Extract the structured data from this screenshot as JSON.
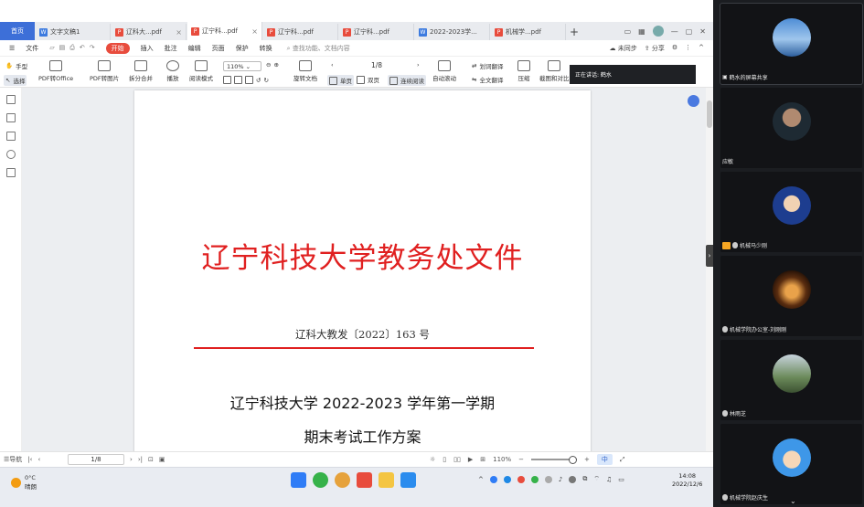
{
  "tabs": {
    "home": "首页",
    "items": [
      {
        "label": "文字文稿1",
        "type": "doc",
        "icon": "W",
        "active": false
      },
      {
        "label": "辽科大...pdf",
        "type": "pdf",
        "icon": "P",
        "active": false
      },
      {
        "label": "辽宁科...pdf",
        "type": "pdf",
        "icon": "P",
        "active": true
      },
      {
        "label": "辽宁科...pdf",
        "type": "pdf",
        "icon": "P",
        "active": false
      },
      {
        "label": "辽宁科...pdf",
        "type": "pdf",
        "icon": "P",
        "active": false
      },
      {
        "label": "2022-2023学...",
        "type": "doc",
        "icon": "W",
        "active": false
      },
      {
        "label": "机械学...pdf",
        "type": "pdf",
        "icon": "P",
        "active": false
      }
    ],
    "plus": "+"
  },
  "menu": {
    "file": "文件",
    "start": "开始",
    "items": [
      "插入",
      "批注",
      "编辑",
      "页面",
      "保护",
      "转换"
    ],
    "search_placeholder": "查找功能、文档内容",
    "sync": "未同步",
    "share": "分享"
  },
  "toolbar": {
    "hand": "手型",
    "select": "选择",
    "pdf_to_office": "PDF转Office",
    "pdf_to_image": "PDF转图片",
    "split_merge": "拆分合并",
    "play": "播放",
    "read_mode": "阅读模式",
    "zoom": "110%",
    "rotate": "旋转文档",
    "page_indicator": "1/8",
    "single_page": "单页",
    "double_page": "双页",
    "continuous": "连续阅读",
    "auto_scroll": "自动滚动",
    "translate": "划词翻译",
    "full_translate": "全文翻译",
    "compress": "压缩",
    "compare": "截图和对比"
  },
  "speaking": {
    "text": "正在讲话: 鹤水"
  },
  "document": {
    "title": "辽宁科技大学教务处文件",
    "number": "辽科大教发〔2022〕163 号",
    "heading": "辽宁科技大学 2022-2023 学年第一学期",
    "subheading": "期末考试工作方案"
  },
  "statusbar": {
    "nav": "导航",
    "page": "1/8",
    "zoom": "110%",
    "lang": "中"
  },
  "taskbar": {
    "temperature": "0°C",
    "weather": "晴朗",
    "time": "14:08",
    "date": "2022/12/6"
  },
  "participants": [
    {
      "name": "鹤水的屏幕共享",
      "host": false
    },
    {
      "name": "应敏",
      "host": false
    },
    {
      "name": "机械马少刚",
      "host": true
    },
    {
      "name": "机械学院办公室-刘刚刚",
      "host": false
    },
    {
      "name": "林雨芝",
      "host": false
    },
    {
      "name": "机械学院赵庆生",
      "host": false
    }
  ],
  "colors": {
    "accent_blue": "#3d6fd8",
    "pdf_red": "#e84c3d",
    "doc_title_red": "#e02020"
  }
}
